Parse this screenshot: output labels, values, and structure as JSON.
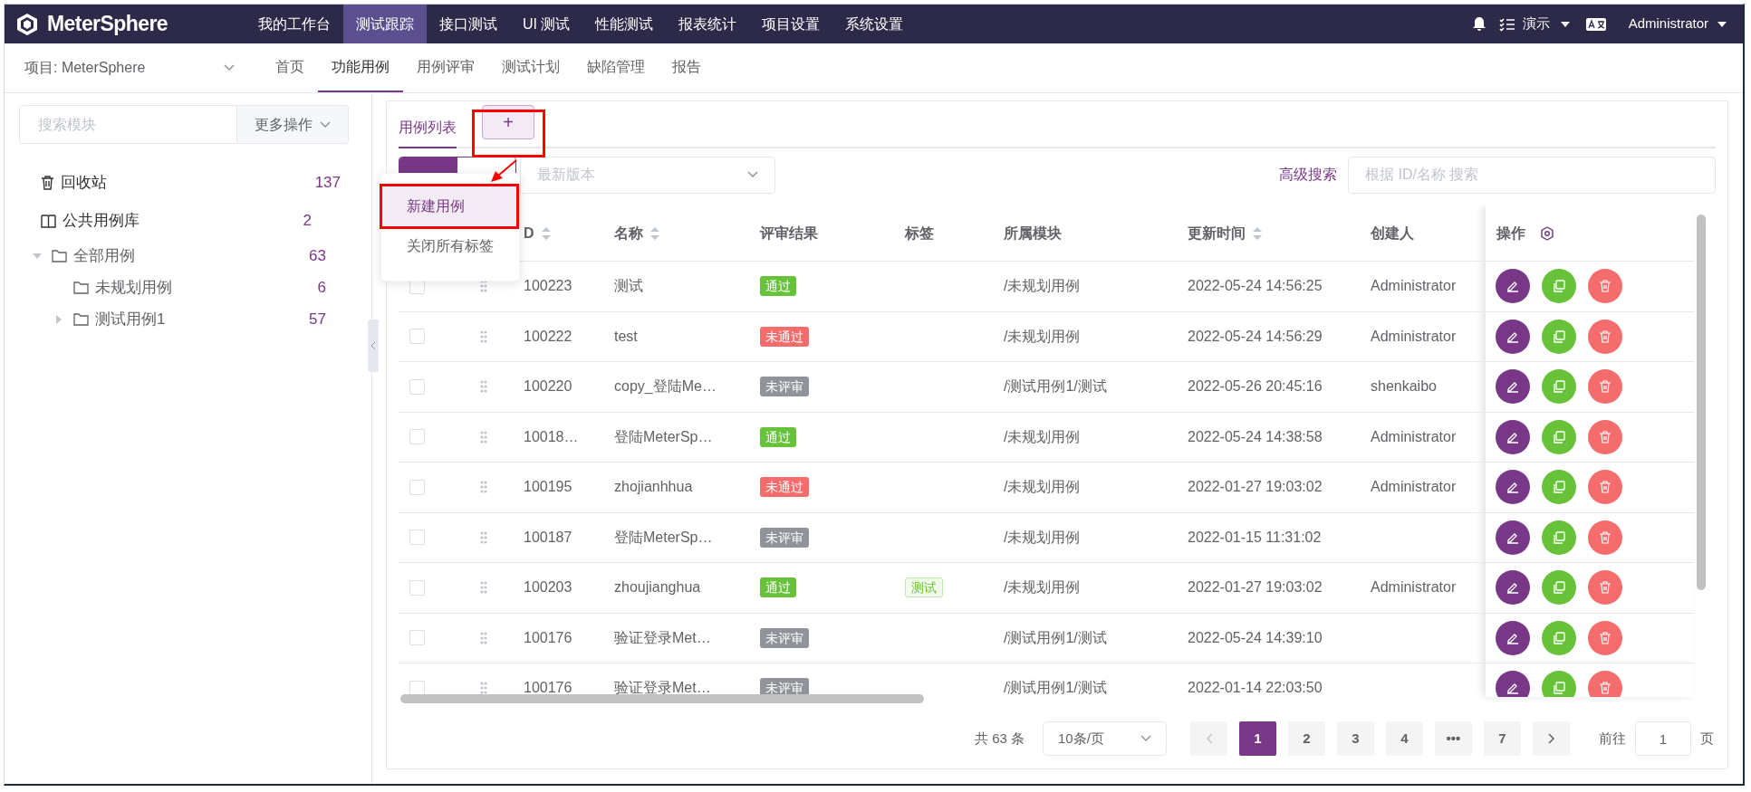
{
  "top_nav": {
    "logo": "MeterSphere",
    "items": [
      {
        "label": "我的工作台",
        "selected": false
      },
      {
        "label": "测试跟踪",
        "selected": true
      },
      {
        "label": "接口测试",
        "selected": false
      },
      {
        "label": "UI 测试",
        "selected": false
      },
      {
        "label": "性能测试",
        "selected": false
      },
      {
        "label": "报表统计",
        "selected": false
      },
      {
        "label": "项目设置",
        "selected": false
      },
      {
        "label": "系统设置",
        "selected": false
      }
    ],
    "workspace": "演示",
    "user": "Administrator"
  },
  "sub_nav": {
    "project": "项目: MeterSphere",
    "tabs": [
      {
        "label": "首页",
        "selected": false
      },
      {
        "label": "功能用例",
        "selected": true
      },
      {
        "label": "用例评审",
        "selected": false
      },
      {
        "label": "测试计划",
        "selected": false
      },
      {
        "label": "缺陷管理",
        "selected": false
      },
      {
        "label": "报告",
        "selected": false
      }
    ]
  },
  "sidebar": {
    "search": {
      "placeholder": "搜索模块"
    },
    "more_button": "更多操作",
    "tree": [
      {
        "kind": "trash",
        "label": "回收站",
        "count": "137"
      },
      {
        "kind": "library",
        "label": "公共用例库",
        "count": "2"
      },
      {
        "kind": "folder",
        "label": "全部用例",
        "count": "63",
        "expanded": true,
        "children": [
          {
            "kind": "folder",
            "label": "未规划用例",
            "count": "6"
          },
          {
            "kind": "folder",
            "label": "测试用例1",
            "count": "57",
            "expanded": false
          }
        ]
      }
    ]
  },
  "content": {
    "tabs": [
      {
        "label": "用例列表",
        "selected": true
      }
    ],
    "add_button": "+",
    "add_menu": [
      {
        "label": "新建用例",
        "selected": true
      },
      {
        "label": "关闭所有标签",
        "selected": false
      }
    ],
    "version_select": {
      "placeholder": "最新版本"
    },
    "advanced_search": "高级搜索",
    "search": {
      "placeholder": "根据 ID/名称 搜索"
    },
    "table": {
      "columns": [
        {
          "label": "D",
          "sortable": true
        },
        {
          "label": "名称",
          "sortable": true
        },
        {
          "label": "评审结果",
          "sortable": false
        },
        {
          "label": "标签",
          "sortable": false
        },
        {
          "label": "所属模块",
          "sortable": false
        },
        {
          "label": "更新时间",
          "sortable": true
        },
        {
          "label": "创建人",
          "sortable": false
        }
      ],
      "actions_column": "操作",
      "rows": [
        {
          "checked": false,
          "id": "100223",
          "name": "测试",
          "review": {
            "text": "通过",
            "kind": "pass"
          },
          "module": "/未规划用例",
          "updated": "2022-05-24 14:56:25",
          "creator": "Administrator"
        },
        {
          "checked": false,
          "id": "100222",
          "name": "test",
          "review": {
            "text": "未通过",
            "kind": "fail"
          },
          "module": "/未规划用例",
          "updated": "2022-05-24 14:56:29",
          "creator": "Administrator"
        },
        {
          "checked": false,
          "id": "100220",
          "name": "copy_登陆Me…",
          "review": {
            "text": "未评审",
            "kind": "pending"
          },
          "module": "/测试用例1/测试",
          "updated": "2022-05-26 20:45:16",
          "creator": "shenkaibo"
        },
        {
          "checked": false,
          "id": "10018…",
          "name": "登陆MeterSp…",
          "review": {
            "text": "通过",
            "kind": "pass"
          },
          "module": "/未规划用例",
          "updated": "2022-05-24 14:38:58",
          "creator": "Administrator"
        },
        {
          "checked": false,
          "id": "100195",
          "name": "zhojianhhua",
          "review": {
            "text": "未通过",
            "kind": "fail"
          },
          "module": "/未规划用例",
          "updated": "2022-01-27 19:03:02",
          "creator": "Administrator"
        },
        {
          "checked": false,
          "id": "100187",
          "name": "登陆MeterSp…",
          "review": {
            "text": "未评审",
            "kind": "pending"
          },
          "module": "/未规划用例",
          "updated": "2022-01-15 11:31:02"
        },
        {
          "checked": false,
          "id": "100203",
          "name": "zhoujianghua",
          "review": {
            "text": "通过",
            "kind": "pass"
          },
          "tag": "测试",
          "module": "/未规划用例",
          "updated": "2022-01-27 19:03:02",
          "creator": "Administrator"
        },
        {
          "checked": false,
          "id": "100176",
          "name": "验证登录Met…",
          "review": {
            "text": "未评审",
            "kind": "pending"
          },
          "module": "/测试用例1/测试",
          "updated": "2022-05-24 14:39:10"
        },
        {
          "checked": false,
          "id": "100176",
          "name": "验证登录Met…",
          "review": {
            "text": "未评审",
            "kind": "pending"
          },
          "module": "/测试用例1/测试",
          "updated": "2022-01-14 22:03:50"
        }
      ]
    },
    "pagination": {
      "total": "共 63 条",
      "page_size": "10条/页",
      "pages": [
        {
          "label": "1",
          "selected": true
        },
        {
          "label": "2",
          "selected": false
        },
        {
          "label": "3",
          "selected": false
        },
        {
          "label": "4",
          "selected": false
        },
        {
          "label": "•••",
          "selected": false
        },
        {
          "label": "7",
          "selected": false
        }
      ],
      "goto_label": "前往",
      "goto_value": "1",
      "goto_suffix": "页"
    }
  }
}
